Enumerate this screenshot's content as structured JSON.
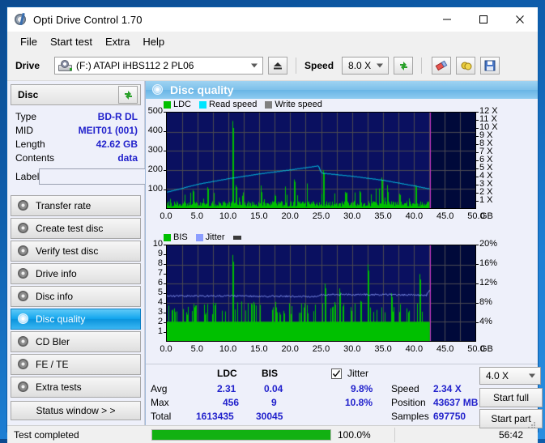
{
  "window": {
    "title": "Opti Drive Control 1.70",
    "app_icon": "disc-icon",
    "minimize": "minimize-icon",
    "maximize": "maximize-icon",
    "close": "close-icon"
  },
  "menu": [
    "File",
    "Start test",
    "Extra",
    "Help"
  ],
  "toolbar": {
    "drive_label": "Drive",
    "drive_value": "(F:)  ATAPI iHBS112  2 PL06",
    "eject_icon": "eject-icon",
    "speed_label": "Speed",
    "speed_value": "8.0 X",
    "refresh_icon": "refresh-icon",
    "eraser_icon": "eraser-icon",
    "bitsetting_icon": "bitsetting-icon",
    "save_icon": "save-icon"
  },
  "disc": {
    "header": "Disc",
    "refresh_icon": "refresh-icon",
    "rows": [
      {
        "key": "Type",
        "value": "BD-R DL"
      },
      {
        "key": "MID",
        "value": "MEIT01 (001)"
      },
      {
        "key": "Length",
        "value": "42.62 GB"
      },
      {
        "key": "Contents",
        "value": "data"
      }
    ],
    "label_key": "Label",
    "label_value": "",
    "label_placeholder": "",
    "label_icon": "disc-label-icon"
  },
  "nav": {
    "items": [
      {
        "label": "Transfer rate",
        "selected": false
      },
      {
        "label": "Create test disc",
        "selected": false
      },
      {
        "label": "Verify test disc",
        "selected": false
      },
      {
        "label": "Drive info",
        "selected": false
      },
      {
        "label": "Disc info",
        "selected": false
      },
      {
        "label": "Disc quality",
        "selected": true
      },
      {
        "label": "CD Bler",
        "selected": false
      },
      {
        "label": "FE / TE",
        "selected": false
      },
      {
        "label": "Extra tests",
        "selected": false
      }
    ],
    "status_window": "Status window > >"
  },
  "panel": {
    "title": "Disc quality",
    "icon": "disc-quality-icon"
  },
  "stats": {
    "col_ldc": "LDC",
    "col_bis": "BIS",
    "jitter_label": "Jitter",
    "jitter_checked": true,
    "rows": [
      {
        "name": "Avg",
        "ldc": "2.31",
        "bis": "0.04",
        "jitter": "9.8%"
      },
      {
        "name": "Max",
        "ldc": "456",
        "bis": "9",
        "jitter": "10.8%"
      },
      {
        "name": "Total",
        "ldc": "1613435",
        "bis": "30045",
        "jitter": ""
      }
    ],
    "speed_key": "Speed",
    "speed_value": "2.34 X",
    "position_key": "Position",
    "position_value": "43637 MB",
    "samples_key": "Samples",
    "samples_value": "697750",
    "speed_select": "4.0 X",
    "start_full": "Start full",
    "start_part": "Start part"
  },
  "statusbar": {
    "text": "Test completed",
    "progress_pct": "100.0%",
    "progress_value": 100,
    "elapsed": "56:42"
  },
  "chart_data": [
    {
      "id": "top",
      "type": "line",
      "title": "LDC / Read speed",
      "xlabel": "GB",
      "ylabel": "LDC",
      "grid": true,
      "legend": [
        {
          "name": "LDC",
          "color": "#00c000"
        },
        {
          "name": "Read speed",
          "color": "#00e5ff"
        },
        {
          "name": "Write speed",
          "color": "#808080"
        }
      ],
      "x": [
        0.0,
        50.0
      ],
      "xticks": [
        "0.0",
        "5.0",
        "10.0",
        "15.0",
        "20.0",
        "25.0",
        "30.0",
        "35.0",
        "40.0",
        "45.0",
        "50.0"
      ],
      "xunit": "GB",
      "ylim": [
        0,
        500
      ],
      "yticks": [
        "100",
        "200",
        "300",
        "400",
        "500"
      ],
      "y2lim": [
        0,
        12
      ],
      "y2ticks": [
        "1 X",
        "2 X",
        "3 X",
        "4 X",
        "5 X",
        "6 X",
        "7 X",
        "8 X",
        "9 X",
        "10 X",
        "11 X",
        "12 X"
      ],
      "data_end_gb": 42.62,
      "marker_color": "#cc33cc",
      "series": [
        {
          "name": "LDC",
          "type": "impulse",
          "color": "#00c000",
          "baseline": 20,
          "max_peak": 456,
          "peaks": [
            {
              "x": 10.6,
              "y": 456
            },
            {
              "x": 25.3,
              "y": 200
            },
            {
              "x": 11.2,
              "y": 120
            },
            {
              "x": 20.6,
              "y": 150
            },
            {
              "x": 34.8,
              "y": 160
            },
            {
              "x": 40.3,
              "y": 120
            },
            {
              "x": 4.2,
              "y": 95
            },
            {
              "x": 6.5,
              "y": 110
            },
            {
              "x": 17.4,
              "y": 70
            },
            {
              "x": 28.9,
              "y": 85
            },
            {
              "x": 31.2,
              "y": 90
            },
            {
              "x": 37.6,
              "y": 75
            }
          ]
        },
        {
          "name": "Read speed",
          "type": "line",
          "color": "#00e5ff",
          "points": [
            {
              "x": 0.0,
              "y2": 2.0
            },
            {
              "x": 5.0,
              "y2": 3.0
            },
            {
              "x": 10.0,
              "y2": 3.7
            },
            {
              "x": 15.0,
              "y2": 4.3
            },
            {
              "x": 20.0,
              "y2": 4.8
            },
            {
              "x": 24.5,
              "y2": 5.3
            },
            {
              "x": 25.0,
              "y2": 4.4
            },
            {
              "x": 30.0,
              "y2": 4.0
            },
            {
              "x": 35.0,
              "y2": 3.5
            },
            {
              "x": 40.0,
              "y2": 2.8
            },
            {
              "x": 42.6,
              "y2": 2.4
            }
          ]
        }
      ]
    },
    {
      "id": "bottom",
      "type": "line",
      "title": "BIS / Jitter",
      "xlabel": "GB",
      "ylabel": "BIS",
      "grid": true,
      "legend": [
        {
          "name": "BIS",
          "color": "#00c000"
        },
        {
          "name": "Jitter",
          "color": "#8c9eff"
        }
      ],
      "x": [
        0.0,
        50.0
      ],
      "xticks": [
        "0.0",
        "5.0",
        "10.0",
        "15.0",
        "20.0",
        "25.0",
        "30.0",
        "35.0",
        "40.0",
        "45.0",
        "50.0"
      ],
      "xunit": "GB",
      "ylim": [
        0,
        10
      ],
      "yticks": [
        "1",
        "2",
        "3",
        "4",
        "5",
        "6",
        "7",
        "8",
        "9",
        "10"
      ],
      "y2lim": [
        0,
        20
      ],
      "y2ticks": [
        "4%",
        "8%",
        "12%",
        "16%",
        "20%"
      ],
      "data_end_gb": 42.62,
      "marker_color": "#cc33cc",
      "series": [
        {
          "name": "BIS",
          "type": "impulse",
          "color": "#00c000",
          "baseline": 2,
          "max_peak": 9,
          "peaks": [
            {
              "x": 10.6,
              "y": 9
            },
            {
              "x": 32.5,
              "y": 8
            },
            {
              "x": 41.0,
              "y": 7
            },
            {
              "x": 25.6,
              "y": 6
            },
            {
              "x": 28.0,
              "y": 5.5
            },
            {
              "x": 36.4,
              "y": 5
            },
            {
              "x": 3.1,
              "y": 3
            },
            {
              "x": 6.0,
              "y": 3
            },
            {
              "x": 18.2,
              "y": 3
            }
          ]
        },
        {
          "name": "Jitter",
          "type": "line",
          "color": "#8c9eff",
          "points": [
            {
              "x": 0.0,
              "y": 4.7
            },
            {
              "x": 12.0,
              "y": 4.7
            },
            {
              "x": 24.5,
              "y": 4.65
            },
            {
              "x": 25.0,
              "y": 4.85
            },
            {
              "x": 35.0,
              "y": 4.85
            },
            {
              "x": 42.0,
              "y": 4.8
            },
            {
              "x": 42.6,
              "y": 5.3
            }
          ]
        }
      ]
    }
  ]
}
